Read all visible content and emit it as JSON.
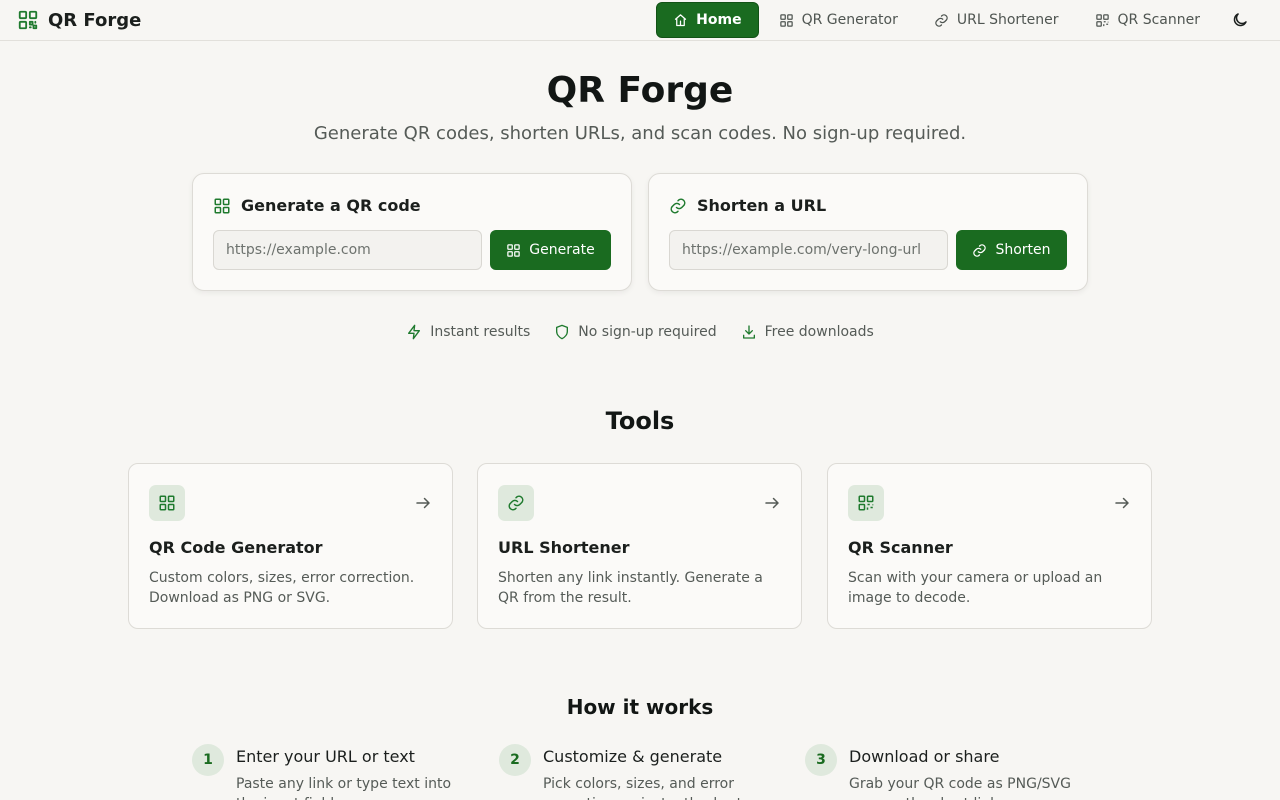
{
  "nav": {
    "brand": "QR Forge",
    "brand_icon": "qr-icon",
    "links": [
      {
        "label": "Home",
        "icon": "home-icon",
        "active": true
      },
      {
        "label": "QR Generator",
        "icon": "qr-icon",
        "active": false
      },
      {
        "label": "URL Shortener",
        "icon": "link-icon",
        "active": false
      },
      {
        "label": "QR Scanner",
        "icon": "scan-icon",
        "active": false
      }
    ],
    "theme_toggle_icon": "moon-icon"
  },
  "hero": {
    "title": "QR Forge",
    "subtitle": "Generate QR codes, shorten URLs, and scan codes. No sign-up required."
  },
  "cards": {
    "generate": {
      "title": "Generate a QR code",
      "icon": "qr-icon",
      "placeholder": "https://example.com",
      "value": "",
      "button": "Generate"
    },
    "shorten": {
      "title": "Shorten a URL",
      "icon": "link-icon",
      "placeholder": "https://example.com/very-long-url",
      "value": "",
      "button": "Shorten"
    }
  },
  "features": [
    {
      "label": "Instant results",
      "icon": "bolt-icon"
    },
    {
      "label": "No sign-up required",
      "icon": "shield-icon"
    },
    {
      "label": "Free downloads",
      "icon": "download-icon"
    }
  ],
  "tools": {
    "title": "Tools",
    "items": [
      {
        "title": "QR Code Generator",
        "description": "Custom colors, sizes, error correction. Download as PNG or SVG.",
        "icon": "qr-icon"
      },
      {
        "title": "URL Shortener",
        "description": "Shorten any link instantly. Generate a QR from the result.",
        "icon": "link-icon"
      },
      {
        "title": "QR Scanner",
        "description": "Scan with your camera or upload an image to decode.",
        "icon": "scan-icon"
      }
    ]
  },
  "how": {
    "title": "How it works",
    "steps": [
      {
        "num": "1",
        "title": "Enter your URL or text",
        "description": "Paste any link or type text into the input field."
      },
      {
        "num": "2",
        "title": "Customize & generate",
        "description": "Pick colors, sizes, and error correction, or instantly shorten it."
      },
      {
        "num": "3",
        "title": "Download or share",
        "description": "Grab your QR code as PNG/SVG or copy the short link."
      }
    ]
  },
  "colors": {
    "accent": "#1a6b20",
    "icon_green": "#1f7a2e",
    "background": "#f7f6f3",
    "card_bg": "#fbfaf8",
    "icon_tile": "#dfe9dd"
  }
}
